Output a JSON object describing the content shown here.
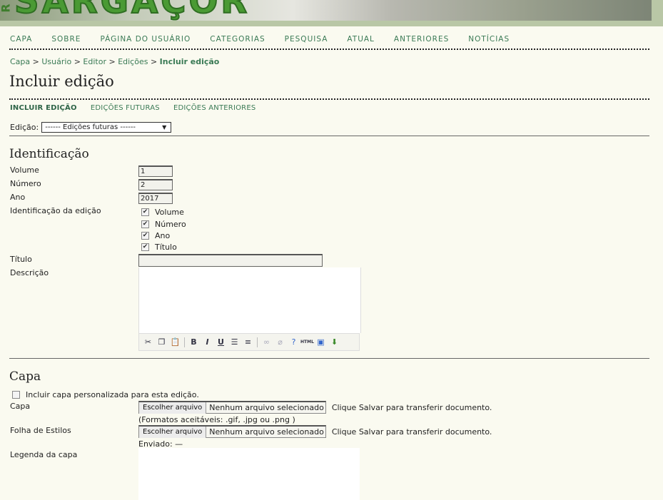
{
  "header": {
    "logo_text": "SARGAÇOR",
    "logo_prefix": "R"
  },
  "nav": [
    "CAPA",
    "SOBRE",
    "PÁGINA DO USUÁRIO",
    "CATEGORIAS",
    "PESQUISA",
    "ATUAL",
    "ANTERIORES",
    "NOTÍCIAS"
  ],
  "breadcrumb": {
    "items": [
      "Capa",
      "Usuário",
      "Editor",
      "Edições"
    ],
    "separator": ">",
    "current": "Incluir edição"
  },
  "page_title": "Incluir edição",
  "subtabs": [
    "INCLUIR EDIÇÃO",
    "EDIÇÕES FUTURAS",
    "EDIÇÕES ANTERIORES"
  ],
  "issue_select": {
    "label": "Edição:",
    "value": "------ Edições futuras ------",
    "arrow": "▼"
  },
  "identification": {
    "title": "Identificação",
    "volume_label": "Volume",
    "volume_value": "1",
    "number_label": "Número",
    "number_value": "2",
    "year_label": "Ano",
    "year_value": "2017",
    "ident_label": "Identificação da edição",
    "checks": [
      {
        "label": "Volume",
        "checked": true
      },
      {
        "label": "Número",
        "checked": true
      },
      {
        "label": "Ano",
        "checked": true
      },
      {
        "label": "Título",
        "checked": true
      }
    ],
    "title_label": "Título",
    "title_value": "",
    "description_label": "Descrição"
  },
  "cover": {
    "title": "Capa",
    "custom_checkbox_label": "Incluir capa personalizada para esta edição.",
    "cover_label": "Capa",
    "choose_file": "Escolher arquivo",
    "no_file": "Nenhum arquivo selecionado",
    "save_hint": "Clique Salvar para transferir documento.",
    "formats": "(Formatos aceitáveis: .gif, .jpg ou .png )",
    "stylesheet_label": "Folha de Estilos",
    "sent": "Enviado: —",
    "caption_label": "Legenda da capa"
  },
  "colors": {
    "link": "#3a7a55",
    "background": "#fafaf0",
    "logo": "#4a9a34"
  }
}
